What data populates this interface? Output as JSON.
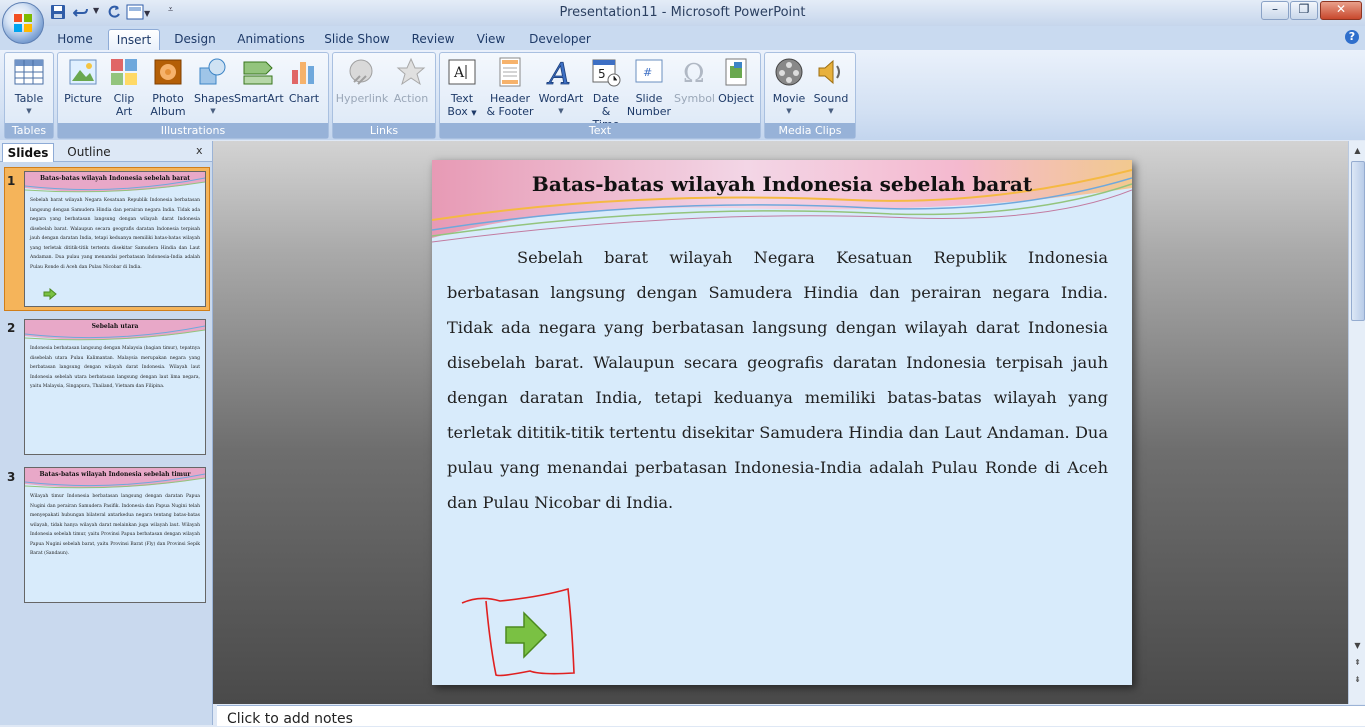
{
  "window": {
    "title": "Presentation11 - Microsoft PowerPoint"
  },
  "tabs": [
    "Home",
    "Insert",
    "Design",
    "Animations",
    "Slide Show",
    "Review",
    "View",
    "Developer"
  ],
  "active_tab": "Insert",
  "ribbon": {
    "tables": {
      "label": "Tables",
      "table": "Table"
    },
    "illustrations": {
      "label": "Illustrations",
      "picture": "Picture",
      "clip_art_1": "Clip",
      "clip_art_2": "Art",
      "photo_album_1": "Photo",
      "photo_album_2": "Album",
      "shapes": "Shapes",
      "smartart": "SmartArt",
      "chart": "Chart"
    },
    "links": {
      "label": "Links",
      "hyperlink": "Hyperlink",
      "action": "Action"
    },
    "text": {
      "label": "Text",
      "text_box_1": "Text",
      "text_box_2": "Box",
      "header_footer_1": "Header",
      "header_footer_2": "& Footer",
      "wordart": "WordArt",
      "date_time_1": "Date",
      "date_time_2": "& Time",
      "slide_number_1": "Slide",
      "slide_number_2": "Number",
      "symbol": "Symbol",
      "object": "Object"
    },
    "media": {
      "label": "Media Clips",
      "movie": "Movie",
      "sound": "Sound"
    }
  },
  "left_pane": {
    "tab_slides": "Slides",
    "tab_outline": "Outline",
    "close": "x",
    "thumbnails": [
      {
        "number": "1",
        "title": "Batas-batas wilayah Indonesia sebelah barat",
        "body": "Sebelah barat wilayah Negara Kesatuan Republik Indonesia berbatasan langsung dengan Samudera Hindia dan perairan negara India. Tidak ada negara yang berbatasan langsung dengan wilayah darat Indonesia disebelah barat. Walaupun secara geografis daratan Indonesia terpisah jauh dengan daratan India, tetapi keduanya memiliki batas-batas wilayah yang terletak dititik-titik tertentu disekitar Samudera Hindia dan Laut Andaman. Dua pulau yang menandai perbatasan Indonesia-India adalah Pulau Ronde di Aceh dan Pulau Nicobar di India."
      },
      {
        "number": "2",
        "title": "Sebelah utara",
        "body": "Indonesia berbatasan langsung dengan Malaysia (bagian timur), tepatnya disebelah utara Pulau Kalimantan. Malaysia merupakan negara yang berbatasan langsung dengan wilayah darat Indonesia. Wilayah laut Indonesia sebelah utara berbatasan langsung dengan laut lima negara, yaitu Malaysia, Singapura, Thailand, Vietnam dan Filipina."
      },
      {
        "number": "3",
        "title": "Batas-batas wilayah Indonesia sebelah timur",
        "body": "Wilayah timur Indonesia berbatasan langsung dengan daratan Papua Nugini dan perairan Samudera Pasifik. Indonesia dan Papua Nugini telah menyepakati hubungan bilateral antarkedua negara tentang batas-batas wilayah, tidak hanya wilayah darat melainkan juga wilayah laut. Wilayah Indonesia sebelah timur, yaitu Provinsi Papua berbatasan dengan wilayah Papua Nugini sebelah barat, yaitu Provinsi Barat (Fly) dan Provinsi Sepik Barat (Sandaun)."
      }
    ]
  },
  "slide": {
    "title": "Batas-batas wilayah Indonesia sebelah barat",
    "body": "Sebelah barat wilayah Negara Kesatuan Republik Indonesia berbatasan langsung dengan Samudera Hindia dan perairan negara India. Tidak ada negara yang berbatasan langsung dengan wilayah darat Indonesia disebelah barat. Walaupun secara geografis daratan Indonesia terpisah jauh dengan daratan India, tetapi keduanya memiliki batas-batas wilayah yang terletak dititik-titik tertentu disekitar Samudera Hindia dan Laut Andaman. Dua pulau yang menandai perbatasan Indonesia-India adalah Pulau Ronde di Aceh dan Pulau Nicobar di India."
  },
  "notes": {
    "placeholder": "Click to add notes"
  },
  "colors": {
    "accent": "#97b2d8",
    "slide_bg": "#d8ebfb",
    "arrow": "#7ac143",
    "annotation": "#e02020"
  }
}
